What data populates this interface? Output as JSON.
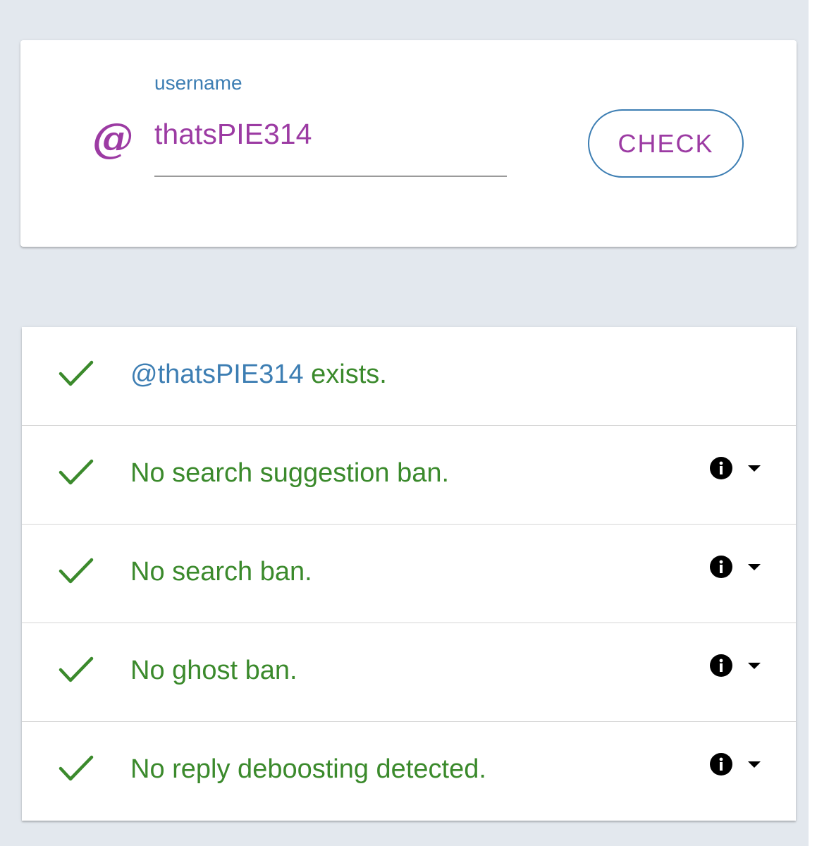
{
  "search": {
    "label": "username",
    "value": "thatsPIE314",
    "button_label": "CHECK",
    "prefix_icon": "at-sign-icon"
  },
  "results": [
    {
      "handle": "@thatsPIE314",
      "text": " exists.",
      "status": "ok",
      "has_info": false
    },
    {
      "text": "No search suggestion ban.",
      "status": "ok",
      "has_info": true
    },
    {
      "text": "No search ban.",
      "status": "ok",
      "has_info": true
    },
    {
      "text": "No ghost ban.",
      "status": "ok",
      "has_info": true
    },
    {
      "text": "No reply deboosting detected.",
      "status": "ok",
      "has_info": true
    }
  ],
  "colors": {
    "accent_purple": "#9c3ba3",
    "accent_blue": "#3d7eb3",
    "success_green": "#3b8a2c",
    "background": "#e3e8ee"
  }
}
